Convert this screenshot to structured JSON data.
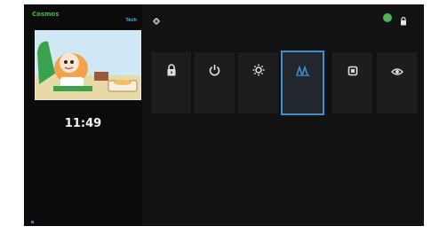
{
  "left_panel": {
    "channel_logo": "Cosmos",
    "program_title": "",
    "program_time": "",
    "channel_badge": "Tech",
    "channel_badge_sub": "",
    "clock": "11:49",
    "date": "",
    "hint": ""
  },
  "top_bar": {
    "settings_label": "",
    "menu_title": "",
    "profile_label": ""
  },
  "section_label": "",
  "tiles": [
    {
      "icon": "lock-icon",
      "label": ""
    },
    {
      "icon": "power-icon",
      "label": ""
    },
    {
      "icon": "brightness-icon",
      "label": ""
    },
    {
      "icon": "users-icon",
      "label": ""
    },
    {
      "icon": "square-icon",
      "label": ""
    },
    {
      "icon": "eye-icon",
      "label": ""
    }
  ],
  "selected_tile_index": 3,
  "colors": {
    "accent_green": "#3fbf3f",
    "accent_blue": "#3d8fcf",
    "badge_blue": "#27b0e8",
    "background": "#121212"
  }
}
